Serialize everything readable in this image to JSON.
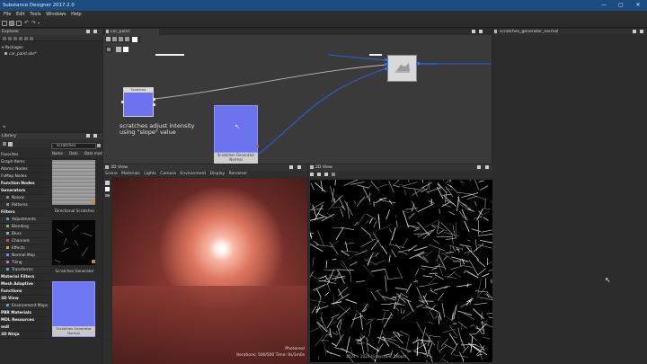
{
  "window": {
    "title": "Substance Designer 2017.2.0",
    "controls": [
      "—",
      "▢",
      "✕"
    ]
  },
  "menu": [
    "File",
    "Edit",
    "Tools",
    "Windows",
    "Help"
  ],
  "explorer": {
    "title": "Explorer",
    "root": "Packages",
    "package": "car_paint.sbs*"
  },
  "library": {
    "title": "Library",
    "categories": [
      {
        "label": "Favorites",
        "bold": false,
        "sub": false
      },
      {
        "label": "Graph Items",
        "bold": false,
        "sub": false
      },
      {
        "label": "Atomic Nodes",
        "bold": false,
        "sub": false
      },
      {
        "label": "FxMap Nodes",
        "bold": false,
        "sub": false
      },
      {
        "label": "Function Nodes",
        "bold": true,
        "sub": false
      },
      {
        "label": "Generators",
        "bold": true,
        "sub": false
      },
      {
        "label": "Noises",
        "bold": false,
        "sub": true,
        "color": "#8b8b8b"
      },
      {
        "label": "Patterns",
        "bold": false,
        "sub": true,
        "color": "#8b8b8b"
      },
      {
        "label": "Filters",
        "bold": true,
        "sub": false
      },
      {
        "label": "Adjustments",
        "bold": false,
        "sub": true,
        "color": "#6b8fd6"
      },
      {
        "label": "Blending",
        "bold": false,
        "sub": true,
        "color": "#7fb36a"
      },
      {
        "label": "Blurs",
        "bold": false,
        "sub": true,
        "color": "#9aa6e0"
      },
      {
        "label": "Channels",
        "bold": false,
        "sub": true,
        "color": "#c05050"
      },
      {
        "label": "Effects",
        "bold": false,
        "sub": true,
        "color": "#c9a24a"
      },
      {
        "label": "Normal Map",
        "bold": false,
        "sub": true,
        "color": "#7a86e8"
      },
      {
        "label": "Tiling",
        "bold": false,
        "sub": true,
        "color": "#c86ad0"
      },
      {
        "label": "Transforms",
        "bold": false,
        "sub": true,
        "color": "#5aa0c8"
      },
      {
        "label": "Material Filters",
        "bold": true,
        "sub": false
      },
      {
        "label": "Mesh Adaptive",
        "bold": true,
        "sub": false
      },
      {
        "label": "Functions",
        "bold": true,
        "sub": false
      },
      {
        "label": "3D View",
        "bold": true,
        "sub": false
      },
      {
        "label": "Environment Maps",
        "bold": false,
        "sub": true,
        "color": "#6aa0d0"
      },
      {
        "label": "PBR Materials",
        "bold": true,
        "sub": false
      },
      {
        "label": "MDL Resources",
        "bold": true,
        "sub": false
      },
      {
        "label": "mdl",
        "bold": true,
        "sub": false
      },
      {
        "label": "3D Ninja",
        "bold": true,
        "sub": false
      }
    ],
    "search": "scratches",
    "columns": [
      "Name",
      "Date",
      "Date mod"
    ],
    "results": [
      "Directional Scratches",
      "Scratches Generator",
      "Scratches Generator Normal"
    ]
  },
  "graph": {
    "tab": "car_paint",
    "annotation": "scratches adjust intensity using \"slope\" value",
    "small_node_title": "Scratches",
    "selected_node_caption": "Scratches Generator Normal"
  },
  "properties": {
    "tab": "scratches_generator_normal"
  },
  "view3d": {
    "title": "3D View",
    "menu": [
      "Scene",
      "Materials",
      "Lights",
      "Camera",
      "Environment",
      "Display",
      "Renderer"
    ],
    "renderer": "Iray",
    "status_mode": "Photoreal",
    "status_line": "Iterations: 500/500  Time: 9s/1m0s"
  },
  "view2d": {
    "title": "2D View",
    "status": "1024 x 1024 (Grayscale, 16bpc)"
  }
}
